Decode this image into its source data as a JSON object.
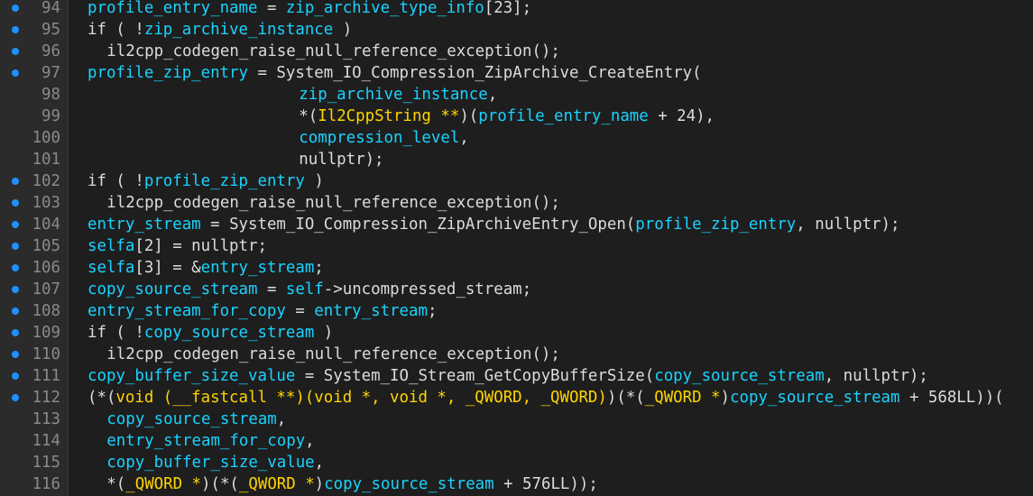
{
  "colors": {
    "background": "#1e1e1e",
    "gutter": "#2b2b2b",
    "line_number": "#8a8a8a",
    "breakpoint_dot": "#1e90ff",
    "variable": "#19d3ff",
    "type": "#ffd400",
    "default_text": "#dcdcdc"
  },
  "lines": [
    {
      "num": "94",
      "dot": true,
      "indent": 0,
      "tokens": [
        {
          "t": "profile_entry_name",
          "c": "v"
        },
        {
          "t": " = ",
          "c": "p"
        },
        {
          "t": "zip_archive_type_info",
          "c": "v"
        },
        {
          "t": "[23];",
          "c": "p"
        }
      ]
    },
    {
      "num": "95",
      "dot": true,
      "indent": 0,
      "tokens": [
        {
          "t": "if",
          "c": "k"
        },
        {
          "t": " ( !",
          "c": "p"
        },
        {
          "t": "zip_archive_instance",
          "c": "v"
        },
        {
          "t": " )",
          "c": "p"
        }
      ]
    },
    {
      "num": "96",
      "dot": true,
      "indent": 1,
      "tokens": [
        {
          "t": "il2cpp_codegen_raise_null_reference_exception();",
          "c": "f"
        }
      ]
    },
    {
      "num": "97",
      "dot": true,
      "indent": 0,
      "tokens": [
        {
          "t": "profile_zip_entry",
          "c": "v"
        },
        {
          "t": " = ",
          "c": "p"
        },
        {
          "t": "System_IO_Compression_ZipArchive_CreateEntry(",
          "c": "f"
        }
      ]
    },
    {
      "num": "98",
      "dot": false,
      "indent": 11,
      "tokens": [
        {
          "t": "zip_archive_instance",
          "c": "v"
        },
        {
          "t": ",",
          "c": "p"
        }
      ]
    },
    {
      "num": "99",
      "dot": false,
      "indent": 11,
      "tokens": [
        {
          "t": "*(",
          "c": "p"
        },
        {
          "t": "Il2CppString **",
          "c": "t"
        },
        {
          "t": ")(",
          "c": "p"
        },
        {
          "t": "profile_entry_name",
          "c": "v"
        },
        {
          "t": " + 24),",
          "c": "p"
        }
      ]
    },
    {
      "num": "100",
      "dot": false,
      "indent": 11,
      "tokens": [
        {
          "t": "compression_level",
          "c": "v"
        },
        {
          "t": ",",
          "c": "p"
        }
      ]
    },
    {
      "num": "101",
      "dot": false,
      "indent": 11,
      "tokens": [
        {
          "t": "nullptr);",
          "c": "n"
        }
      ]
    },
    {
      "num": "102",
      "dot": true,
      "indent": 0,
      "tokens": [
        {
          "t": "if",
          "c": "k"
        },
        {
          "t": " ( !",
          "c": "p"
        },
        {
          "t": "profile_zip_entry",
          "c": "v"
        },
        {
          "t": " )",
          "c": "p"
        }
      ]
    },
    {
      "num": "103",
      "dot": true,
      "indent": 1,
      "tokens": [
        {
          "t": "il2cpp_codegen_raise_null_reference_exception();",
          "c": "f"
        }
      ]
    },
    {
      "num": "104",
      "dot": true,
      "indent": 0,
      "tokens": [
        {
          "t": "entry_stream",
          "c": "v"
        },
        {
          "t": " = ",
          "c": "p"
        },
        {
          "t": "System_IO_Compression_ZipArchiveEntry_Open(",
          "c": "f"
        },
        {
          "t": "profile_zip_entry",
          "c": "v"
        },
        {
          "t": ", nullptr);",
          "c": "p"
        }
      ]
    },
    {
      "num": "105",
      "dot": true,
      "indent": 0,
      "tokens": [
        {
          "t": "selfa",
          "c": "v"
        },
        {
          "t": "[2] = nullptr;",
          "c": "p"
        }
      ]
    },
    {
      "num": "106",
      "dot": true,
      "indent": 0,
      "tokens": [
        {
          "t": "selfa",
          "c": "v"
        },
        {
          "t": "[3] = &",
          "c": "p"
        },
        {
          "t": "entry_stream",
          "c": "v"
        },
        {
          "t": ";",
          "c": "p"
        }
      ]
    },
    {
      "num": "107",
      "dot": true,
      "indent": 0,
      "tokens": [
        {
          "t": "copy_source_stream",
          "c": "v"
        },
        {
          "t": " = ",
          "c": "p"
        },
        {
          "t": "self",
          "c": "v"
        },
        {
          "t": "->uncompressed_stream;",
          "c": "p"
        }
      ]
    },
    {
      "num": "108",
      "dot": true,
      "indent": 0,
      "tokens": [
        {
          "t": "entry_stream_for_copy",
          "c": "v"
        },
        {
          "t": " = ",
          "c": "p"
        },
        {
          "t": "entry_stream",
          "c": "v"
        },
        {
          "t": ";",
          "c": "p"
        }
      ]
    },
    {
      "num": "109",
      "dot": true,
      "indent": 0,
      "tokens": [
        {
          "t": "if",
          "c": "k"
        },
        {
          "t": " ( !",
          "c": "p"
        },
        {
          "t": "copy_source_stream",
          "c": "v"
        },
        {
          "t": " )",
          "c": "p"
        }
      ]
    },
    {
      "num": "110",
      "dot": true,
      "indent": 1,
      "tokens": [
        {
          "t": "il2cpp_codegen_raise_null_reference_exception();",
          "c": "f"
        }
      ]
    },
    {
      "num": "111",
      "dot": true,
      "indent": 0,
      "tokens": [
        {
          "t": "copy_buffer_size_value",
          "c": "v"
        },
        {
          "t": " = ",
          "c": "p"
        },
        {
          "t": "System_IO_Stream_GetCopyBufferSize(",
          "c": "f"
        },
        {
          "t": "copy_source_stream",
          "c": "v"
        },
        {
          "t": ", nullptr);",
          "c": "p"
        }
      ]
    },
    {
      "num": "112",
      "dot": true,
      "indent": 0,
      "tokens": [
        {
          "t": "(*(",
          "c": "p"
        },
        {
          "t": "void (__fastcall **)(void *, void *, _QWORD, _QWORD)",
          "c": "t"
        },
        {
          "t": ")(*(",
          "c": "p"
        },
        {
          "t": "_QWORD *",
          "c": "t"
        },
        {
          "t": ")",
          "c": "p"
        },
        {
          "t": "copy_source_stream",
          "c": "v"
        },
        {
          "t": " + 568LL))(",
          "c": "p"
        }
      ]
    },
    {
      "num": "113",
      "dot": false,
      "indent": 1,
      "tokens": [
        {
          "t": "copy_source_stream",
          "c": "v"
        },
        {
          "t": ",",
          "c": "p"
        }
      ]
    },
    {
      "num": "114",
      "dot": false,
      "indent": 1,
      "tokens": [
        {
          "t": "entry_stream_for_copy",
          "c": "v"
        },
        {
          "t": ",",
          "c": "p"
        }
      ]
    },
    {
      "num": "115",
      "dot": false,
      "indent": 1,
      "tokens": [
        {
          "t": "copy_buffer_size_value",
          "c": "v"
        },
        {
          "t": ",",
          "c": "p"
        }
      ]
    },
    {
      "num": "116",
      "dot": false,
      "indent": 1,
      "tokens": [
        {
          "t": "*(",
          "c": "p"
        },
        {
          "t": "_QWORD *",
          "c": "t"
        },
        {
          "t": ")(*(",
          "c": "p"
        },
        {
          "t": "_QWORD *",
          "c": "t"
        },
        {
          "t": ")",
          "c": "p"
        },
        {
          "t": "copy_source_stream",
          "c": "v"
        },
        {
          "t": " + 576LL));",
          "c": "p"
        }
      ]
    }
  ]
}
